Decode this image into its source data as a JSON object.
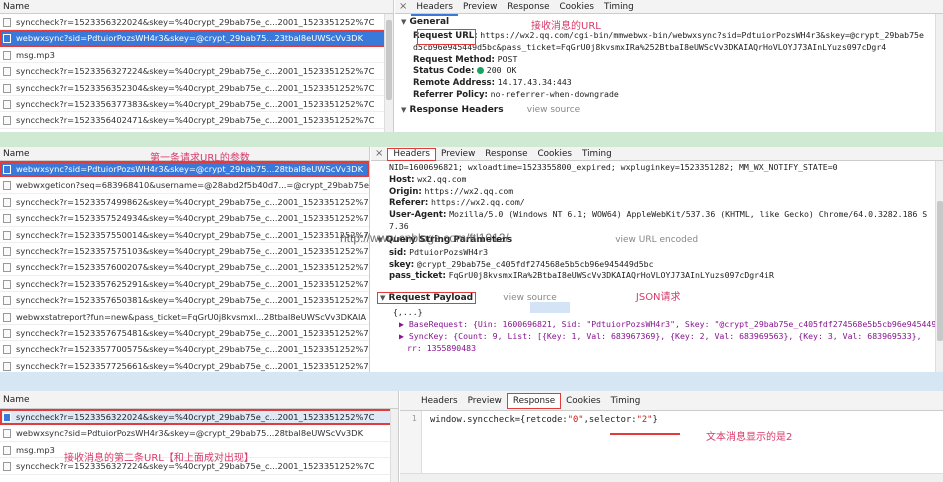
{
  "p1": {
    "list_header": "Name",
    "rows": [
      "synccheck?r=1523356322024&skey=%40crypt_29bab75e_c...2001_1523351252%7C",
      "webwxsync?sid=PdtuiorPozsWH4r3&skey=@crypt_29bab75...23tbal8eUWScVv3DK",
      "msg.mp3",
      "synccheck?r=1523356327224&skey=%40crypt_29bab75e_c...2001_1523351252%7C",
      "synccheck?r=1523356352304&skey=%40crypt_29bab75e_c...2001_1523351252%7C",
      "synccheck?r=1523356377383&skey=%40crypt_29bab75e_c...2001_1523351252%7C",
      "synccheck?r=1523356402471&skey=%40crypt_29bab75e_c...2001_1523351252%7C"
    ],
    "tabs": [
      "×",
      "Headers",
      "Preview",
      "Response",
      "Cookies",
      "Timing"
    ],
    "general_title": "General",
    "annot_url": "接收消息的URL",
    "req_url_k": "Request URL:",
    "req_url_v": "https://wx2.qq.com/cgi-bin/mmwebwx-bin/webwxsync?sid=PdtuiorPozsWH4r3&skey=@crypt_29bab75e",
    "req_url_v2": "d5cb96e945449d5bc&pass_ticket=FqGrU0j8kvsmxIRa%252BtbaI8eUWScVv3DKAIAQrHoVLOYJ73AInLYuzs097cDgr4",
    "method_k": "Request Method:",
    "method_v": "POST",
    "status_k": "Status Code:",
    "status_v": "200 OK",
    "remote_k": "Remote Address:",
    "remote_v": "14.17.43.34:443",
    "ref_k": "Referrer Policy:",
    "ref_v": "no-referrer-when-downgrade",
    "resp_headers": "Response Headers",
    "view_source": "view source"
  },
  "p2": {
    "list_header": "Name",
    "annot": "第一条请求URL的参数",
    "rows": [
      "webwxsync?sid=PdtuiorPozsWH4r3&skey=@crypt_29bab75...28tbal8eUWScVv3DK",
      "webwxgeticon?seq=683968410&username=@28abd2f5b40d7...=@crypt_29bab75e",
      "synccheck?r=1523357499862&skey=%40crypt_29bab75e_c...2001_1523351252%7C",
      "synccheck?r=1523357524934&skey=%40crypt_29bab75e_c...2001_1523351252%7C",
      "synccheck?r=1523357550014&skey=%40crypt_29bab75e_c...2001_1523351252%7C",
      "synccheck?r=1523357575103&skey=%40crypt_29bab75e_c...2001_1523351252%7C",
      "synccheck?r=1523357600207&skey=%40crypt_29bab75e_c...2001_1523351252%7C",
      "synccheck?r=1523357625291&skey=%40crypt_29bab75e_c...2001_1523351252%7C",
      "synccheck?r=1523357650381&skey=%40crypt_29bab75e_c...2001_1523351252%7C",
      "webwxstatreport?fun=new&pass_ticket=FqGrU0j8kvsmxI...28tbal8eUWScVv3DKAIA",
      "synccheck?r=1523357675481&skey=%40crypt_29bab75e_c...2001_1523351252%7C",
      "synccheck?r=1523357700575&skey=%40crypt_29bab75e_c...2001_1523351252%7C",
      "synccheck?r=1523357725661&skey=%40crypt_29bab75e_c...2001_1523351252%7C"
    ],
    "tabs": [
      "×",
      "Headers",
      "Preview",
      "Response",
      "Cookies",
      "Timing"
    ],
    "cookie_line": "NID=1600696821; wxloadtime=1523355800_expired; wxpluginkey=1523351282; MM_WX_NOTIFY_STATE=0",
    "host_k": "Host:",
    "host_v": "wx2.qq.com",
    "origin_k": "Origin:",
    "origin_v": "https://wx2.qq.com",
    "referer_k": "Referer:",
    "referer_v": "https://wx2.qq.com/",
    "ua_k": "User-Agent:",
    "ua_v": "Mozilla/5.0 (Windows NT 6.1; WOW64) AppleWebKit/537.36 (KHTML, like Gecko) Chrome/64.0.3282.186 S",
    "ua_v2": "7.36",
    "qsp_title": "Query String Parameters",
    "view_url_encoded": "view URL encoded",
    "sid_k": "sid:",
    "sid_v": "PdtuiorPozsWH4r3",
    "skey_k": "skey:",
    "skey_v": "@crypt_29bab75e_c405fdf274568e5b5cb96e945449d5bc",
    "pt_k": "pass_ticket:",
    "pt_v": "FqGrU0j8kvsmxIRa%2BtbaI8eUWScVv3DKAIAQrHoVLOYJ73AInLYuzs097cDgr4iR",
    "payload_title": "Request Payload",
    "payload_view_source": "view source",
    "payload_annot": "JSON请求",
    "json_open": "{,...}",
    "base_req": "▶ BaseRequest: {Uin: 1600696821, Sid: \"PdtuiorPozsWH4r3\", Skey: \"@crypt_29bab75e_c405fdf274568e5b5cb96e945449",
    "sync_key": "▶ SyncKey: {Count: 9, List: [{Key: 1, Val: 683967369}, {Key: 2, Val: 683969563}, {Key: 3, Val: 683969533},",
    "rr": "rr: 1355890483",
    "watermark": "http://www.cnblogs.com/ftl1012/"
  },
  "p3": {
    "list_header": "Name",
    "rows": [
      "synccheck?r=1523356322024&skey=%40crypt_29bab75e_c...2001_1523351252%7C",
      "webwxsync?sid=PdtuiorPozsWH4r3&skey=@crypt_29bab75...28tbal8eUWScVv3DK",
      "msg.mp3",
      "synccheck?r=1523356327224&skey=%40crypt_29bab75e_c...2001_1523351252%7C"
    ],
    "annot": "接收消息的第二条URL【和上面成对出现】",
    "tabs": [
      "Headers",
      "Preview",
      "Response",
      "Cookies",
      "Timing"
    ],
    "line_no": "1",
    "code_a": "window.synccheck={retcode:",
    "code_b": "\"0\"",
    "code_c": ",selector:",
    "code_d": "\"2\"",
    "code_e": "}",
    "result_annot": "文本消息显示的是2"
  }
}
